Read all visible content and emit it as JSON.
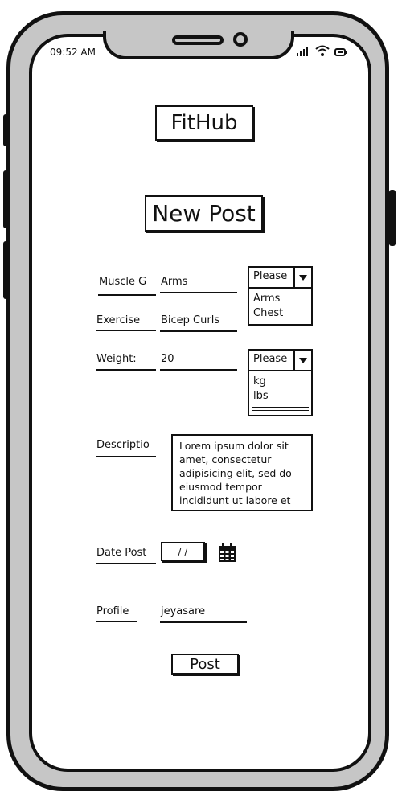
{
  "status_bar": {
    "time": "09:52 AM"
  },
  "app": {
    "title": "FitHub"
  },
  "page": {
    "title": "New Post"
  },
  "form": {
    "muscle_group": {
      "label": "Muscle G",
      "value": "Arms",
      "dropdown": {
        "selected": "Please",
        "options": [
          "Arms",
          "Chest"
        ]
      }
    },
    "exercise": {
      "label": "Exercise",
      "value": "Bicep Curls"
    },
    "weight": {
      "label": "Weight:",
      "value": "20",
      "dropdown": {
        "selected": "Please",
        "options": [
          "kg",
          "lbs"
        ]
      }
    },
    "description": {
      "label": "Descriptio",
      "value": "Lorem ipsum dolor sit amet, consectetur adipisicing elit, sed do eiusmod tempor incididunt ut labore et"
    },
    "date_posted": {
      "label": "Date Post",
      "value": "/ /"
    },
    "profile": {
      "label": "Profile",
      "value": "jeyasare"
    },
    "post_button": "Post"
  }
}
